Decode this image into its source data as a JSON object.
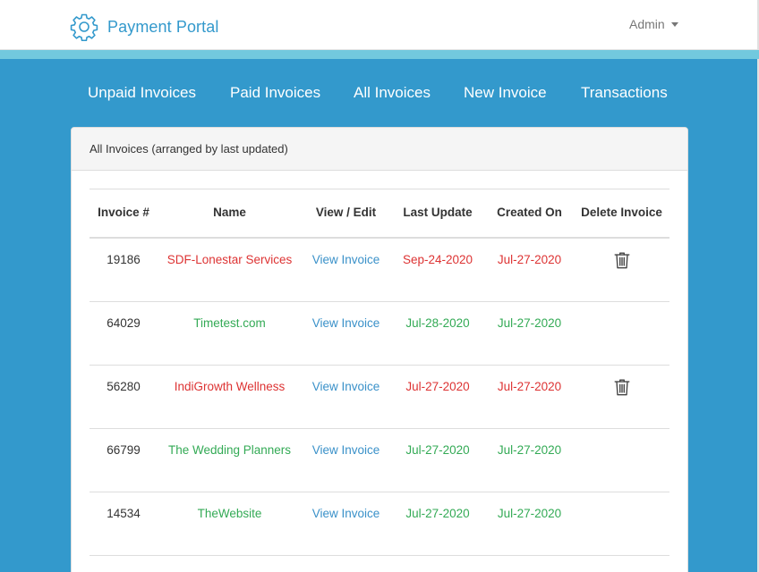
{
  "header": {
    "brand": "Payment Portal",
    "user_menu": "Admin"
  },
  "icons": {
    "brand": "gear-icon",
    "user_menu": "caret-down-icon",
    "delete": "trash-icon"
  },
  "colors": {
    "primary": "#3399cc",
    "accent_strip": "#72c9de",
    "overdue": "#dd3333",
    "ok": "#33aa55",
    "link": "#3a91c9"
  },
  "nav": {
    "items": [
      "Unpaid Invoices",
      "Paid Invoices",
      "All Invoices",
      "New Invoice",
      "Transactions"
    ]
  },
  "panel": {
    "title": "All Invoices (arranged by last updated)"
  },
  "table": {
    "headers": {
      "invoice": "Invoice #",
      "name": "Name",
      "view": "View / Edit",
      "last_update": "Last Update",
      "created_on": "Created On",
      "delete": "Delete Invoice"
    },
    "rows": [
      {
        "id": "19186",
        "name": "SDF-Lonestar Services",
        "view": "View Invoice",
        "last_update": "Sep-24-2020",
        "created_on": "Jul-27-2020",
        "status": "red",
        "deletable": true
      },
      {
        "id": "64029",
        "name": "Timetest.com",
        "view": "View Invoice",
        "last_update": "Jul-28-2020",
        "created_on": "Jul-27-2020",
        "status": "green",
        "deletable": false
      },
      {
        "id": "56280",
        "name": "IndiGrowth Wellness",
        "view": "View Invoice",
        "last_update": "Jul-27-2020",
        "created_on": "Jul-27-2020",
        "status": "red",
        "deletable": true
      },
      {
        "id": "66799",
        "name": "The Wedding Planners",
        "view": "View Invoice",
        "last_update": "Jul-27-2020",
        "created_on": "Jul-27-2020",
        "status": "green",
        "deletable": false
      },
      {
        "id": "14534",
        "name": "TheWebsite",
        "view": "View Invoice",
        "last_update": "Jul-27-2020",
        "created_on": "Jul-27-2020",
        "status": "green",
        "deletable": false
      }
    ]
  }
}
